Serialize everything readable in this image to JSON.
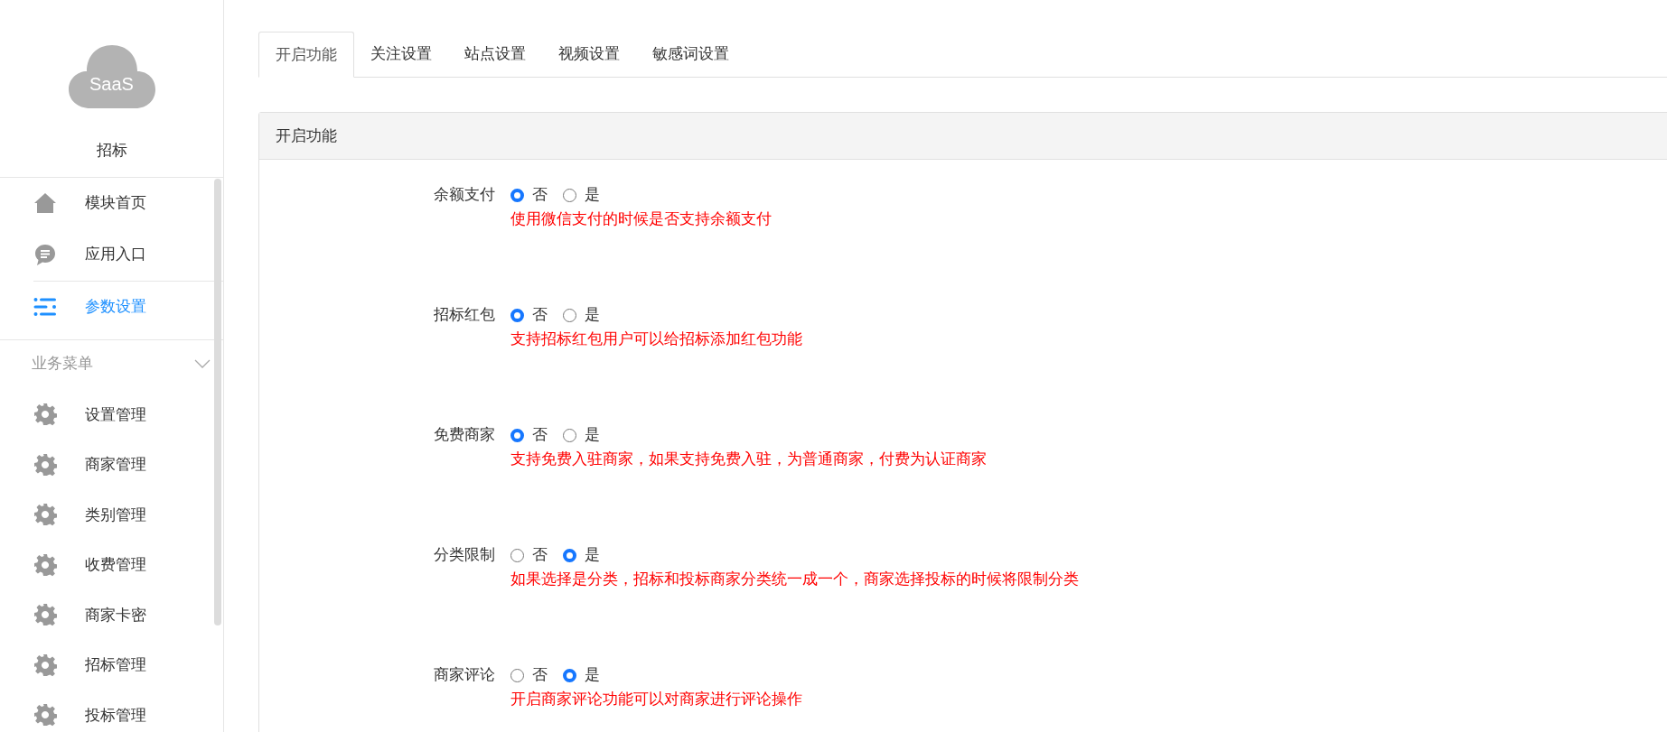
{
  "sidebar": {
    "logo_text": "SaaS",
    "app_name": "招标",
    "top_items": [
      {
        "label": "模块首页",
        "selected": false
      },
      {
        "label": "应用入口",
        "selected": false
      },
      {
        "label": "参数设置",
        "selected": true
      }
    ],
    "section": {
      "title": "业务菜单",
      "expanded": true,
      "items": [
        {
          "label": "设置管理"
        },
        {
          "label": "商家管理"
        },
        {
          "label": "类别管理"
        },
        {
          "label": "收费管理"
        },
        {
          "label": "商家卡密"
        },
        {
          "label": "招标管理"
        },
        {
          "label": "投标管理"
        }
      ]
    }
  },
  "tabs": [
    {
      "label": "开启功能",
      "selected": true
    },
    {
      "label": "关注设置",
      "selected": false
    },
    {
      "label": "站点设置",
      "selected": false
    },
    {
      "label": "视频设置",
      "selected": false
    },
    {
      "label": "敏感词设置",
      "selected": false
    }
  ],
  "panel": {
    "title": "开启功能",
    "fields": [
      {
        "label": "余额支付",
        "options": [
          {
            "label": "否",
            "selected": true
          },
          {
            "label": "是",
            "selected": false
          }
        ],
        "help": "使用微信支付的时候是否支持余额支付"
      },
      {
        "label": "招标红包",
        "options": [
          {
            "label": "否",
            "selected": true
          },
          {
            "label": "是",
            "selected": false
          }
        ],
        "help": "支持招标红包用户可以给招标添加红包功能"
      },
      {
        "label": "免费商家",
        "options": [
          {
            "label": "否",
            "selected": true
          },
          {
            "label": "是",
            "selected": false
          }
        ],
        "help": "支持免费入驻商家，如果支持免费入驻，为普通商家，付费为认证商家"
      },
      {
        "label": "分类限制",
        "options": [
          {
            "label": "否",
            "selected": false
          },
          {
            "label": "是",
            "selected": true
          }
        ],
        "help": "如果选择是分类，招标和投标商家分类统一成一个，商家选择投标的时候将限制分类"
      },
      {
        "label": "商家评论",
        "options": [
          {
            "label": "否",
            "selected": false
          },
          {
            "label": "是",
            "selected": true
          }
        ],
        "help": "开启商家评论功能可以对商家进行评论操作"
      }
    ]
  }
}
